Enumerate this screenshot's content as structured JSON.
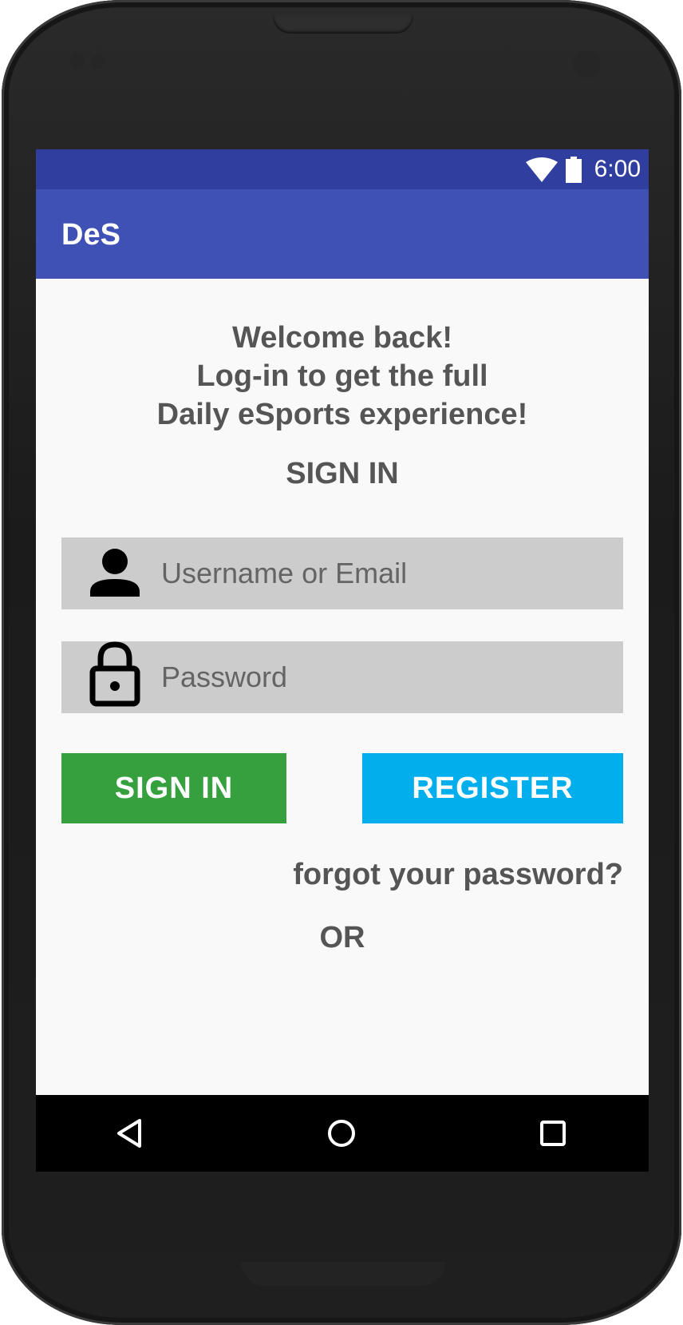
{
  "status_bar": {
    "time": "6:00",
    "wifi_icon": "wifi-icon",
    "battery_icon": "battery-icon",
    "background": "#303f9f"
  },
  "app_bar": {
    "title": "DeS",
    "background": "#3f51b5"
  },
  "welcome": {
    "line1": "Welcome back!",
    "line2": "Log-in to get the full",
    "line3": "Daily eSports experience!"
  },
  "sign_in_heading": "SIGN IN",
  "username_field": {
    "placeholder": "Username or Email",
    "value": "",
    "icon": "person-icon"
  },
  "password_field": {
    "placeholder": "Password",
    "value": "",
    "icon": "lock-icon"
  },
  "buttons": {
    "sign_in_label": "SIGN IN",
    "sign_in_color": "#36a03e",
    "register_label": "REGISTER",
    "register_color": "#03aeec"
  },
  "forgot_password": "forgot your password?",
  "or_label": "OR",
  "nav_bar": {
    "back_icon": "back-triangle-icon",
    "home_icon": "home-circle-icon",
    "recents_icon": "recents-square-icon"
  }
}
